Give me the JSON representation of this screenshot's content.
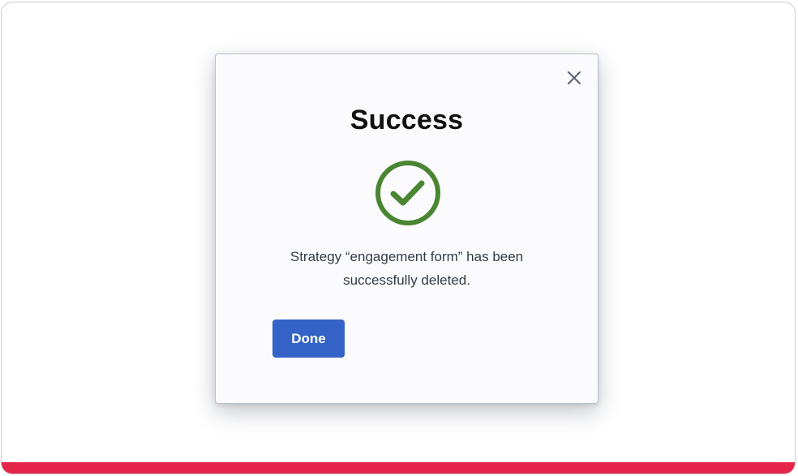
{
  "dialog": {
    "title": "Success",
    "message_line1": "Strategy “engagement form” has been",
    "message_line2": "successfully deleted.",
    "done_label": "Done",
    "close_icon": "close-icon",
    "status_icon": "check-circle-icon"
  },
  "colors": {
    "accent_button": "#3462c6",
    "success_green": "#4a8532",
    "bottom_bar": "#e5254a"
  }
}
